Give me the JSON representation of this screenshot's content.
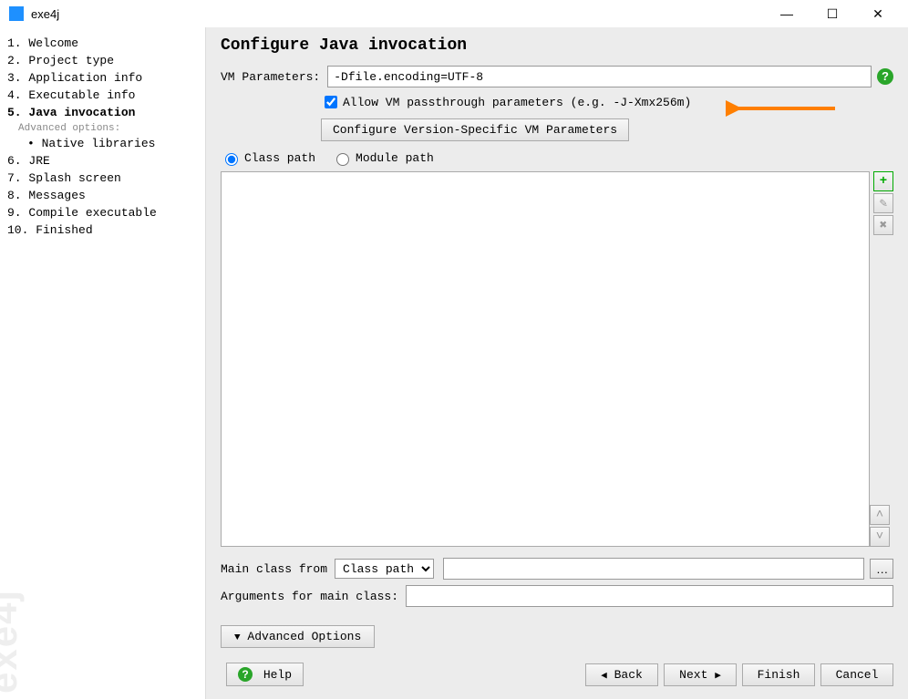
{
  "window": {
    "title": "exe4j"
  },
  "sidebar": {
    "steps": [
      {
        "n": "1.",
        "label": "Welcome"
      },
      {
        "n": "2.",
        "label": "Project type"
      },
      {
        "n": "3.",
        "label": "Application info"
      },
      {
        "n": "4.",
        "label": "Executable info"
      },
      {
        "n": "5.",
        "label": "Java invocation",
        "current": true
      }
    ],
    "advanced_label": "Advanced options:",
    "subitems": [
      {
        "bullet": "•",
        "label": "Native libraries"
      }
    ],
    "steps_after": [
      {
        "n": "6.",
        "label": "JRE"
      },
      {
        "n": "7.",
        "label": "Splash screen"
      },
      {
        "n": "8.",
        "label": "Messages"
      },
      {
        "n": "9.",
        "label": "Compile executable"
      },
      {
        "n": "10.",
        "label": "Finished"
      }
    ],
    "watermark": "exe4j"
  },
  "main": {
    "heading": "Configure Java invocation",
    "vm_params_label": "VM Parameters:",
    "vm_params_value": "-Dfile.encoding=UTF-8",
    "allow_passthrough_label": "Allow VM passthrough parameters (e.g. -J-Xmx256m)",
    "allow_passthrough_checked": true,
    "configure_version_btn": "Configure Version-Specific VM Parameters",
    "radio_classpath": "Class path",
    "radio_modulepath": "Module path",
    "radio_selected": "classpath",
    "main_class_from_label": "Main class from",
    "main_class_from_options": [
      "Class path"
    ],
    "main_class_from_selected": "Class path",
    "main_class_value": "",
    "arguments_label": "Arguments for main class:",
    "arguments_value": "",
    "advanced_options_btn": "Advanced Options",
    "help_btn": "Help",
    "back_btn": "Back",
    "next_btn": "Next",
    "finish_btn": "Finish",
    "cancel_btn": "Cancel"
  },
  "icons": {
    "help": "?",
    "add": "+",
    "minimize": "—",
    "maximize": "☐",
    "close": "✕"
  }
}
